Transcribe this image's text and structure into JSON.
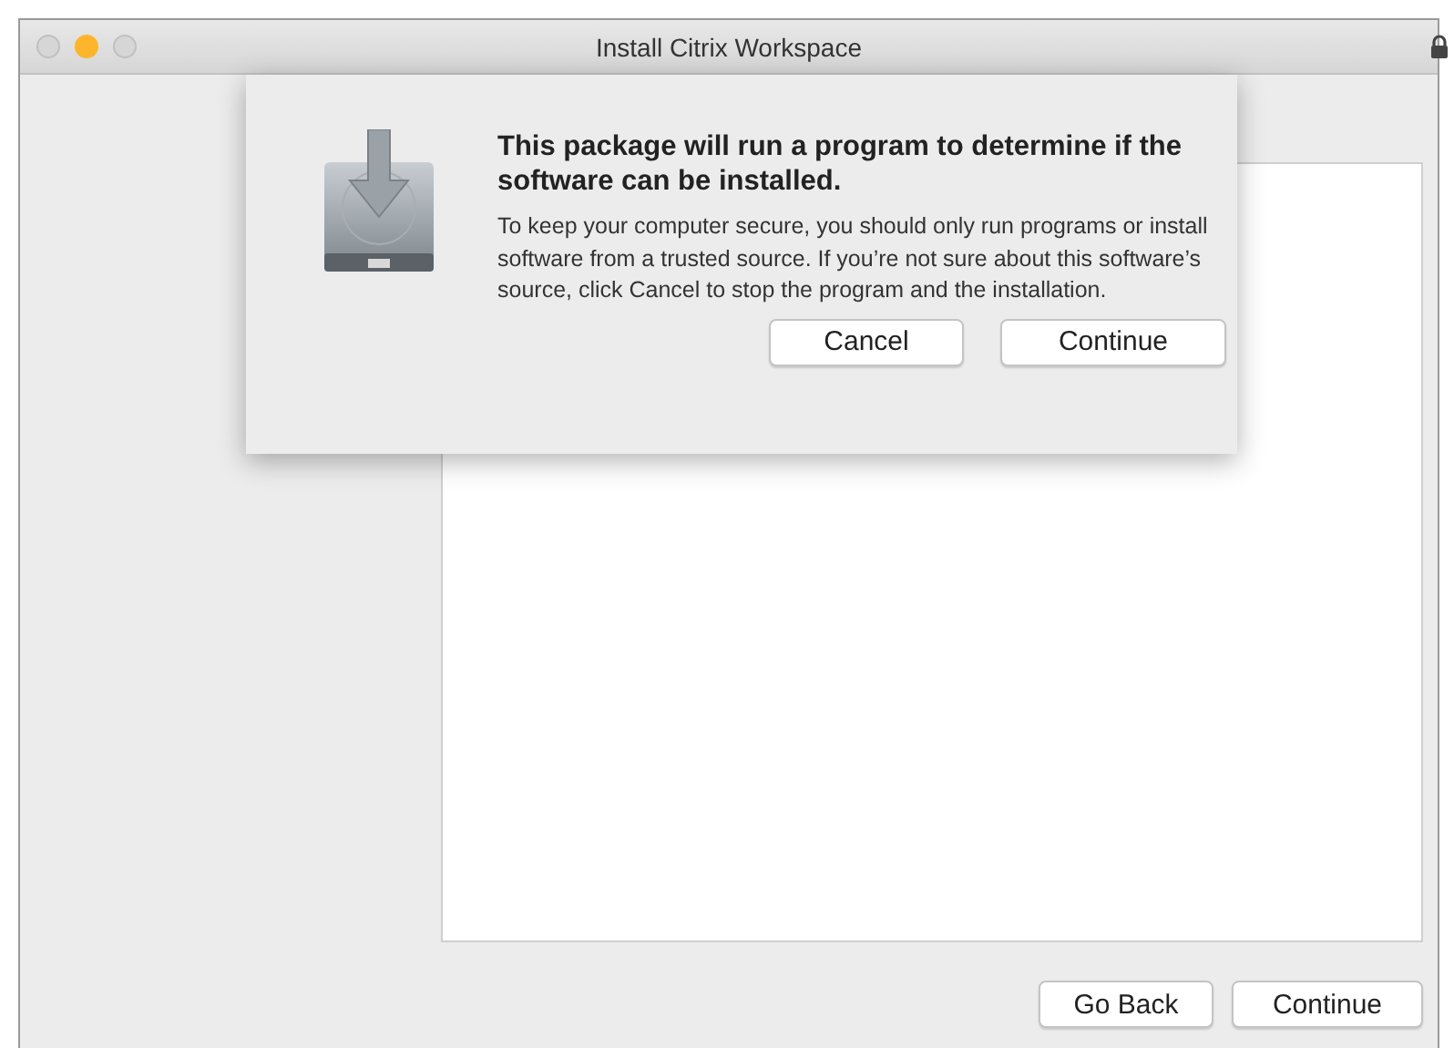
{
  "window": {
    "title": "Install Citrix Workspace"
  },
  "sheet": {
    "heading": "This package will run a program to determine if the software can be installed.",
    "message": "To keep your computer secure, you should only run programs or install software from a trusted source. If you’re not sure about this software’s source, click Cancel to stop the program and the installation.",
    "buttons": [
      {
        "label": "Cancel"
      },
      {
        "label": "Continue"
      }
    ]
  },
  "footer_buttons": [
    {
      "label": "Go Back"
    },
    {
      "label": "Continue"
    }
  ]
}
